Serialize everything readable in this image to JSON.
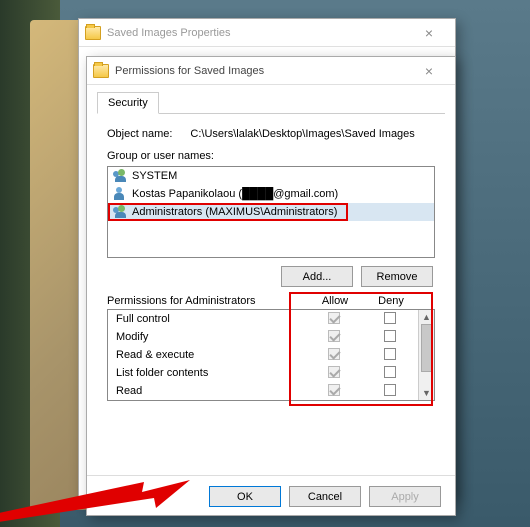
{
  "back_window": {
    "title": "Saved Images Properties"
  },
  "window": {
    "title": "Permissions for Saved Images",
    "tab": "Security",
    "object_name_label": "Object name:",
    "object_name_value": "C:\\Users\\lalak\\Desktop\\Images\\Saved Images",
    "group_label": "Group or user names:",
    "users": [
      {
        "icon": "group",
        "label": "SYSTEM"
      },
      {
        "icon": "person",
        "label": "Kostas Papanikolaou (████@gmail.com)"
      },
      {
        "icon": "group",
        "label": "Administrators (MAXIMUS\\Administrators)"
      }
    ],
    "add_label": "Add...",
    "remove_label": "Remove",
    "perm_header": "Permissions for Administrators",
    "allow_label": "Allow",
    "deny_label": "Deny",
    "permissions": [
      {
        "name": "Full control",
        "allow": true,
        "deny": false
      },
      {
        "name": "Modify",
        "allow": true,
        "deny": false
      },
      {
        "name": "Read & execute",
        "allow": true,
        "deny": false
      },
      {
        "name": "List folder contents",
        "allow": true,
        "deny": false
      },
      {
        "name": "Read",
        "allow": true,
        "deny": false
      }
    ],
    "ok_label": "OK",
    "cancel_label": "Cancel",
    "apply_label": "Apply"
  },
  "highlights": {
    "selected_user_index": 2,
    "red_boxes": [
      "administrators-row",
      "allow-deny-grid"
    ],
    "arrow_target": "ok-button"
  }
}
